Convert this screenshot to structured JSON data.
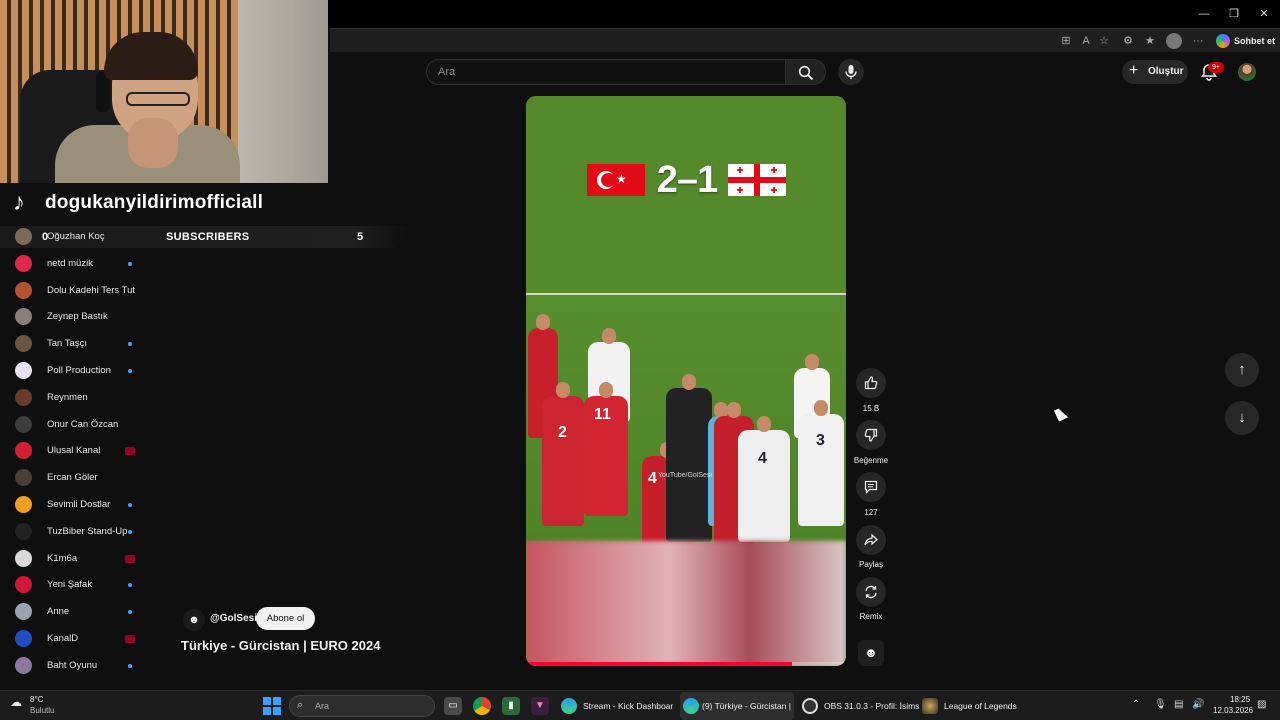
{
  "window": {
    "minimize": "—",
    "restore": "❐",
    "close": "✕"
  },
  "browser": {
    "copilot_label": "Sohbet et"
  },
  "youtube": {
    "search_placeholder": "Ara",
    "create_label": "Oluştur",
    "notification_count": "9+"
  },
  "overlay": {
    "tiktok_username": "dogukanyildirimofficiall",
    "subscribers_label": "SUBSCRIBERS",
    "subscribers_count": "5",
    "subscribers_marker": "0"
  },
  "sidebar": {
    "channels": [
      {
        "name": "Oğuzhan Koç",
        "color": "#7a6a5a",
        "marker": ""
      },
      {
        "name": "netd müzik",
        "color": "#e0284a",
        "marker": "dot"
      },
      {
        "name": "Dolu Kadehi Ters Tut",
        "color": "#b5532f",
        "marker": ""
      },
      {
        "name": "Zeynep Bastık",
        "color": "#8a7f77",
        "marker": ""
      },
      {
        "name": "Tan Taşçı",
        "color": "#6d5546",
        "marker": "dot"
      },
      {
        "name": "Poll Production",
        "color": "#e8e0f0",
        "marker": "dot"
      },
      {
        "name": "Reynmen",
        "color": "#6b3b2b",
        "marker": ""
      },
      {
        "name": "Onur Can Özcan",
        "color": "#3d3d3d",
        "marker": ""
      },
      {
        "name": "Ulusal Kanal",
        "color": "#d32032",
        "marker": "live"
      },
      {
        "name": "Ercan Göler",
        "color": "#4a3f36",
        "marker": ""
      },
      {
        "name": "Sevimli Dostlar",
        "color": "#f0a020",
        "marker": "dot"
      },
      {
        "name": "TuzBiber Stand-Up",
        "color": "#222222",
        "marker": "dot"
      },
      {
        "name": "K1m6a",
        "color": "#d8d8d8",
        "marker": "live"
      },
      {
        "name": "Yeni Şafak",
        "color": "#d0173a",
        "marker": "dot"
      },
      {
        "name": "Anne",
        "color": "#9aa4b0",
        "marker": "dot"
      },
      {
        "name": "KanalD",
        "color": "#2050c0",
        "marker": "live"
      },
      {
        "name": "Baht Oyunu",
        "color": "#8a78a0",
        "marker": "dot"
      }
    ]
  },
  "short": {
    "score": "2–1",
    "watermark": "YouTube/GolSesi",
    "progress": 0.83,
    "channel_handle": "@GolSesi",
    "subscribe_label": "Abone ol",
    "title": "Türkiye - Gürcistan | EURO 2024"
  },
  "actions": {
    "likes": "15 B",
    "dislike_label": "Beğenme",
    "comments": "127",
    "share_label": "Paylaş",
    "remix_label": "Remix"
  },
  "taskbar": {
    "weather_temp": "8°C",
    "weather_desc": "Bulutlu",
    "search_placeholder": "Ara",
    "tasks": [
      {
        "title": "Stream - Kick Dashboar"
      },
      {
        "title": "(9) Türkiye - Gürcistan |"
      },
      {
        "title": "OBS 31.0.3 - Profil: İsims"
      },
      {
        "title": "League of Legends"
      }
    ],
    "time": "18:25",
    "date": "12.03.2026"
  }
}
